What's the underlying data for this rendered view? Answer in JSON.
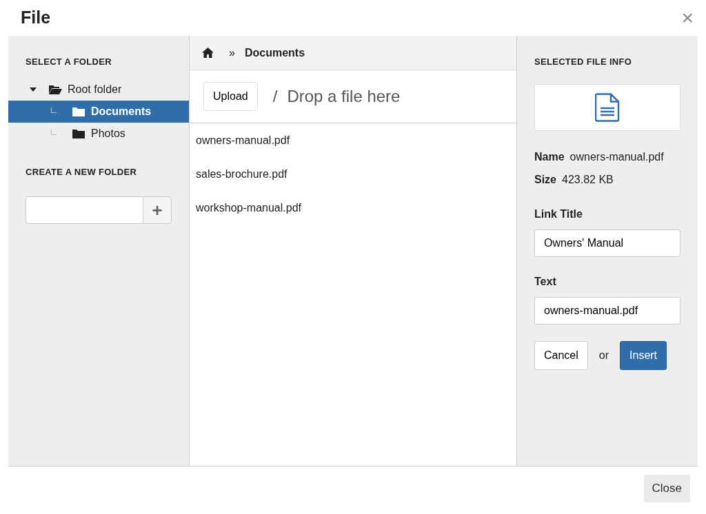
{
  "window": {
    "title": "File",
    "close": "×"
  },
  "folders": {
    "heading": "SELECT A FOLDER",
    "tree": [
      {
        "label": "Root folder",
        "expanded": true,
        "selected": false,
        "children": [
          {
            "label": "Documents",
            "selected": true
          },
          {
            "label": "Photos",
            "selected": false
          }
        ]
      }
    ]
  },
  "new_folder": {
    "heading": "CREATE A NEW FOLDER",
    "add": "+"
  },
  "breadcrumb": {
    "separator": "»",
    "current": "Documents"
  },
  "upload": {
    "button": "Upload",
    "separator": "/",
    "drop_text": "Drop a file here"
  },
  "files": [
    {
      "name": "owners-manual.pdf"
    },
    {
      "name": "sales-brochure.pdf"
    },
    {
      "name": "workshop-manual.pdf"
    }
  ],
  "info": {
    "heading": "SELECTED FILE INFO",
    "name_label": "Name",
    "name": "owners-manual.pdf",
    "size_label": "Size",
    "size": "423.82 KB",
    "link_title_label": "Link Title",
    "link_title": "Owners' Manual",
    "text_label": "Text",
    "text": "owners-manual.pdf",
    "cancel": "Cancel",
    "or": "or",
    "insert": "Insert"
  },
  "footer": {
    "close": "Close"
  }
}
